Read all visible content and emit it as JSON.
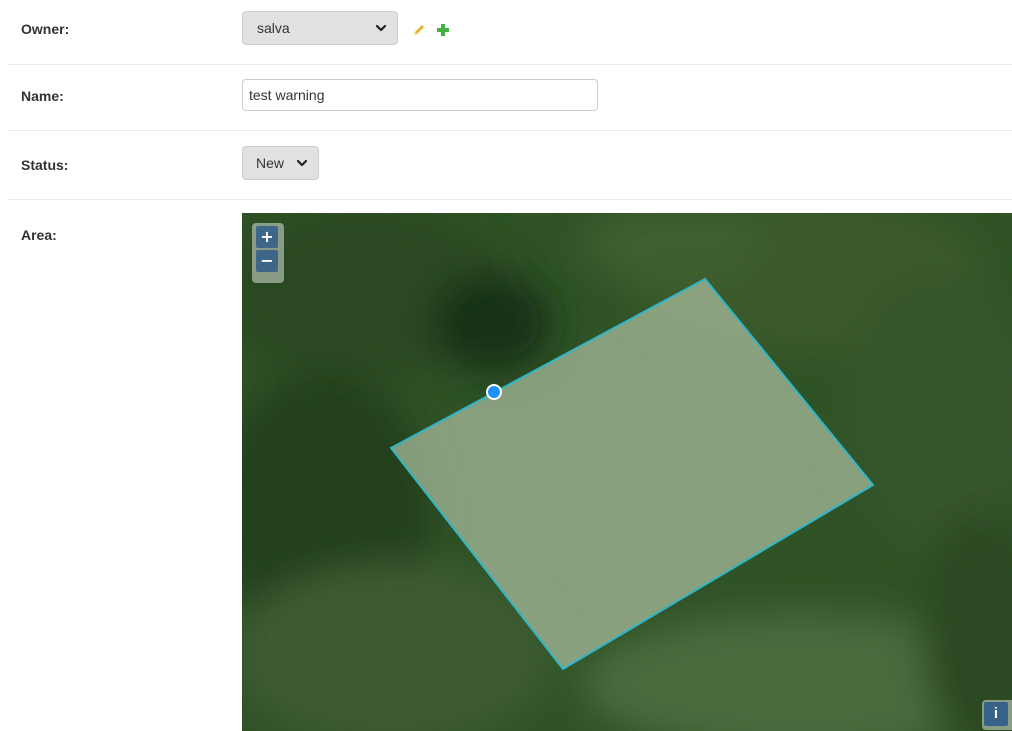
{
  "fields": {
    "owner": {
      "label": "Owner:",
      "value": "salva"
    },
    "name": {
      "label": "Name:",
      "value": "test warning"
    },
    "status": {
      "label": "Status:",
      "value": "New"
    },
    "area": {
      "label": "Area:"
    }
  },
  "icons": {
    "edit": "pencil-icon",
    "add": "plus-icon",
    "edit_color": "#e6b422",
    "add_color": "#3fb23f"
  },
  "map": {
    "zoom_in": "+",
    "zoom_out": "−",
    "info": "i",
    "polygon_stroke": "#2fb6c8",
    "vertex_color": "#1e90ff"
  }
}
